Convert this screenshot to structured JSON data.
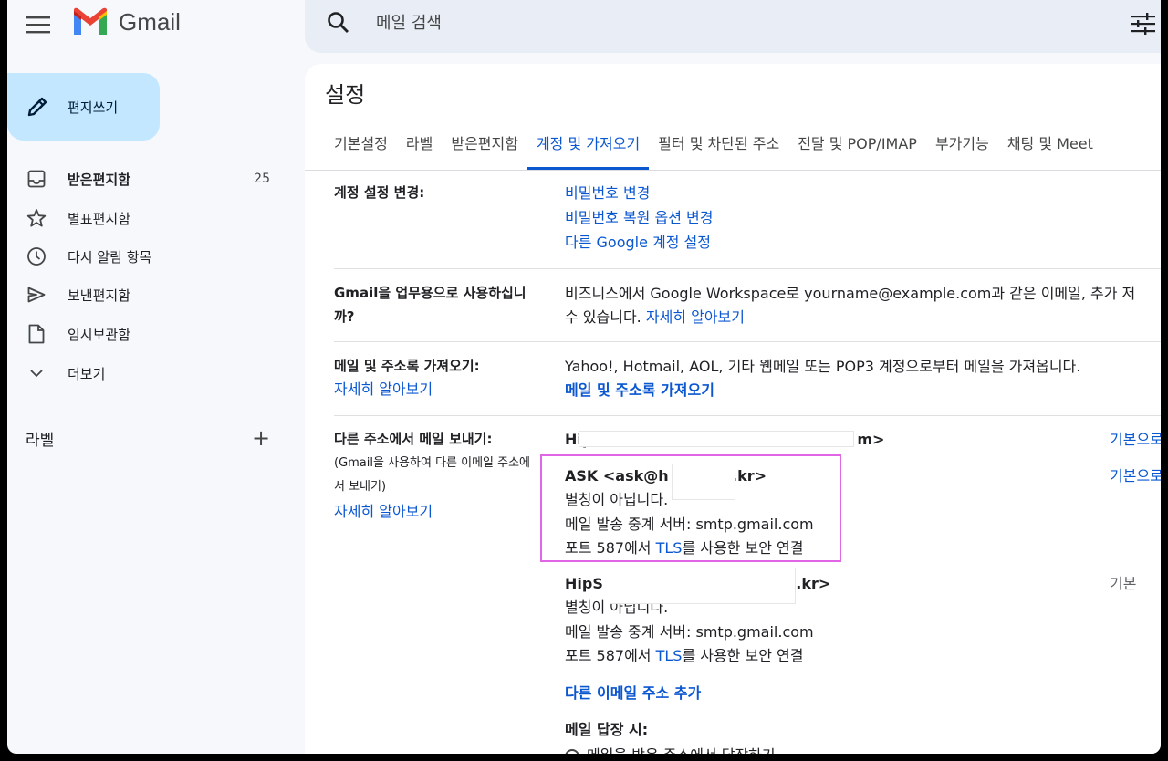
{
  "app": {
    "name": "Gmail"
  },
  "search": {
    "placeholder": "메일 검색"
  },
  "sidebar": {
    "compose_label": "편지쓰기",
    "items": [
      {
        "label": "받은편지함",
        "count": "25",
        "icon": "inbox-icon"
      },
      {
        "label": "별표편지함",
        "icon": "star-icon"
      },
      {
        "label": "다시 알림 항목",
        "icon": "clock-icon"
      },
      {
        "label": "보낸편지함",
        "icon": "send-icon"
      },
      {
        "label": "임시보관함",
        "icon": "draft-icon"
      },
      {
        "label": "더보기",
        "icon": "chevron-down-icon"
      }
    ],
    "labels_heading": "라벨",
    "labels_add": "+"
  },
  "settings": {
    "title": "설정",
    "tabs": [
      "기본설정",
      "라벨",
      "받은편지함",
      "계정 및 가져오기",
      "필터 및 차단된 주소",
      "전달 및 POP/IMAP",
      "부가기능",
      "채팅 및 Meet"
    ],
    "active_tab": "계정 및 가져오기",
    "sections": {
      "account": {
        "label": "계정 설정 변경:",
        "links": [
          "비밀번호 변경",
          "비밀번호 복원 옵션 변경",
          "다른 Google 계정 설정"
        ]
      },
      "business": {
        "label_line1": "Gmail을 업무용으로 사용하십니",
        "label_line2": "까?",
        "text_line1": "비즈니스에서 Google Workspace로 yourname@example.com과 같은 이메일, 추가 저",
        "text_line2": "수 있습니다.",
        "learn_more": "자세히 알아보기"
      },
      "import": {
        "label": "메일 및 주소록 가져오기:",
        "learn_more": "자세히 알아보기",
        "text": "Yahoo!, Hotmail, AOL, 기타 웹메일 또는 POP3 계정으로부터 메일을 가져옵니다.",
        "action": "메일 및 주소록 가져오기"
      },
      "send_as": {
        "label": "다른 주소에서 메일 보내기:",
        "sub_line1": "(Gmail을 사용하여 다른 이메일 주소에",
        "sub_line2": "서 보내기)",
        "learn_more": "자세히 알아보기",
        "entries": [
          {
            "addr_start": "Hip",
            "addr_end": "m>",
            "right": "기본으로"
          },
          {
            "addr_start": "ASK <ask@h",
            "addr_end": "h.kr>",
            "right": "기본으로",
            "alias": "별칭이 아닙니다.",
            "server": "메일 발송 중계 서버: smtp.gmail.com",
            "port_prefix": "포트 587에서 ",
            "port_link": "TLS",
            "port_suffix": "를 사용한 보안 연결"
          },
          {
            "addr_start": "HipS",
            "addr_end": "h.kr>",
            "right": "기본",
            "alias": "별칭이 아닙니다.",
            "server": "메일 발송 중계 서버: smtp.gmail.com",
            "port_prefix": "포트 587에서 ",
            "port_link": "TLS",
            "port_suffix": "를 사용한 보안 연결"
          }
        ],
        "add_address": "다른 이메일 주소 추가",
        "reply_label": "메일 답장 시:",
        "reply_option": "메일을 받은 주소에서 답장하기"
      }
    }
  },
  "colors": {
    "accent": "#0b57d0",
    "compose_bg": "#c2e7ff",
    "highlight": "#e066e6"
  }
}
